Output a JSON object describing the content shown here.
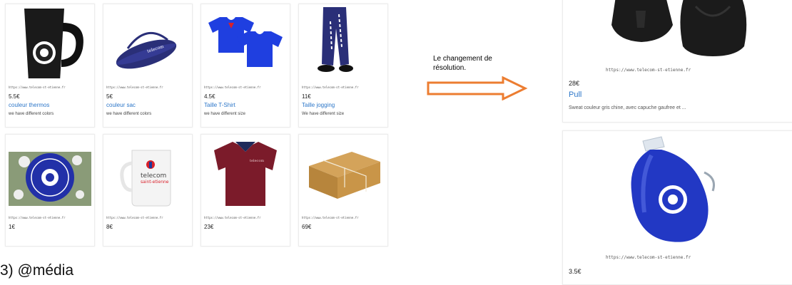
{
  "grid_products": [
    {
      "url": "https://www.telecom-st-etienne.fr",
      "price": "5.5€",
      "name": "couleur thermos",
      "desc": "we have different colors"
    },
    {
      "url": "https://www.telecom-st-etienne.fr",
      "price": "5€",
      "name": "couleur sac",
      "desc": "we have different colors"
    },
    {
      "url": "https://www.telecom-st-etienne.fr",
      "price": "4.5€",
      "name": "Taille T-Shirt",
      "desc": "we have different size"
    },
    {
      "url": "https://www.telecom-st-etienne.fr",
      "price": "11€",
      "name": "Taille jogging",
      "desc": "We have different size"
    },
    {
      "url": "https://www.telecom-st-etienne.fr",
      "price": "1€",
      "name": "",
      "desc": ""
    },
    {
      "url": "https://www.telecom-st-etienne.fr",
      "price": "8€",
      "name": "",
      "desc": ""
    },
    {
      "url": "https://www.telecom-st-etienne.fr",
      "price": "23€",
      "name": "",
      "desc": ""
    },
    {
      "url": "https://www.telecom-st-etienne.fr",
      "price": "69€",
      "name": "",
      "desc": ""
    }
  ],
  "mug_logo_text": {
    "line1": "telecom",
    "line2": "saint-etienne"
  },
  "annotation": {
    "text": "Le changement de résolution."
  },
  "large_products": [
    {
      "url": "https://www.telecom-st-etienne.fr",
      "price": "28€",
      "name": "Pull",
      "desc": "Sweat couleur gris chine, avec capuche gaufree et ..."
    },
    {
      "url": "https://www.telecom-st-etienne.fr",
      "price": "3.5€",
      "name": "",
      "desc": ""
    }
  ],
  "bottom_heading": "3)  @média",
  "colors": {
    "link": "#2d77c9",
    "arrow": "#ec7d31",
    "navy": "#2a2f78",
    "tshirt_blue": "#1f3fe0",
    "polo": "#7b1b2a",
    "bottle_blue": "#2238c4"
  }
}
